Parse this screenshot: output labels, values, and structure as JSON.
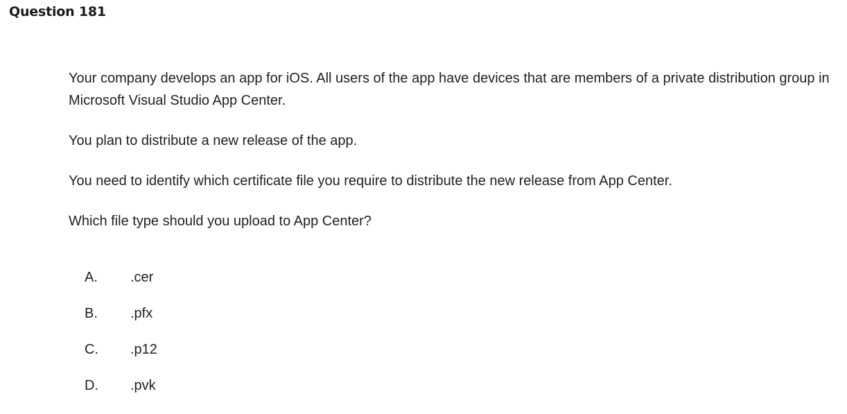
{
  "question": {
    "title": "Question 181",
    "paragraphs": [
      "Your company develops an app for iOS. All users of the app have devices that are members of a private distribution group in Microsoft Visual Studio App Center.",
      "You plan to distribute a new release of the app.",
      "You need to identify which certificate file you require to distribute the new release from App Center.",
      "Which file type should you upload to App Center?"
    ],
    "options": [
      {
        "letter": "A.",
        "text": ".cer"
      },
      {
        "letter": "B.",
        "text": ".pfx"
      },
      {
        "letter": "C.",
        "text": ".p12"
      },
      {
        "letter": "D.",
        "text": ".pvk"
      }
    ]
  }
}
